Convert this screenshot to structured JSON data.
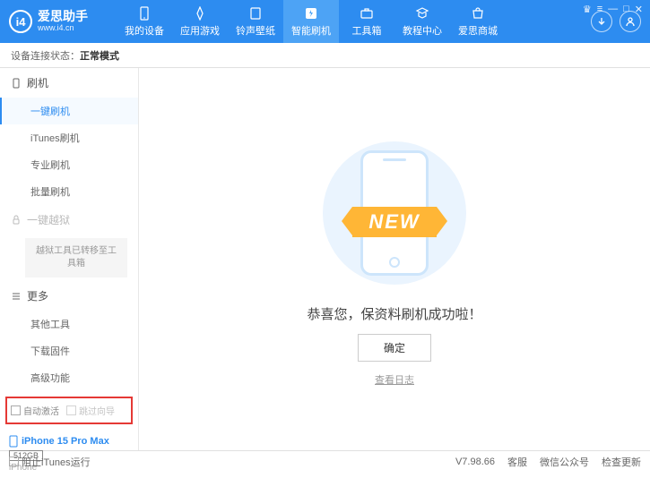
{
  "header": {
    "logo_text": "爱思助手",
    "logo_sub": "www.i4.cn",
    "nav": [
      {
        "label": "我的设备"
      },
      {
        "label": "应用游戏"
      },
      {
        "label": "铃声壁纸"
      },
      {
        "label": "智能刷机"
      },
      {
        "label": "工具箱"
      },
      {
        "label": "教程中心"
      },
      {
        "label": "爱思商城"
      }
    ],
    "active_nav": 3
  },
  "status": {
    "prefix": "设备连接状态：",
    "value": "正常模式"
  },
  "sidebar": {
    "group_flash": "刷机",
    "items_flash": [
      {
        "label": "一键刷机",
        "active": true
      },
      {
        "label": "iTunes刷机"
      },
      {
        "label": "专业刷机"
      },
      {
        "label": "批量刷机"
      }
    ],
    "group_jailbreak": "一键越狱",
    "jailbreak_note": "越狱工具已转移至工具箱",
    "group_more": "更多",
    "items_more": [
      {
        "label": "其他工具"
      },
      {
        "label": "下载固件"
      },
      {
        "label": "高级功能"
      }
    ],
    "checkboxes": {
      "auto_activate": "自动激活",
      "skip_guide": "跳过向导"
    },
    "device": {
      "name": "iPhone 15 Pro Max",
      "storage": "512GB",
      "type": "iPhone"
    }
  },
  "main": {
    "new_label": "NEW",
    "success_text": "恭喜您，保资料刷机成功啦！",
    "confirm_btn": "确定",
    "log_link": "查看日志"
  },
  "footer": {
    "block_itunes": "阻止iTunes运行",
    "version": "V7.98.66",
    "links": [
      "客服",
      "微信公众号",
      "检查更新"
    ]
  }
}
